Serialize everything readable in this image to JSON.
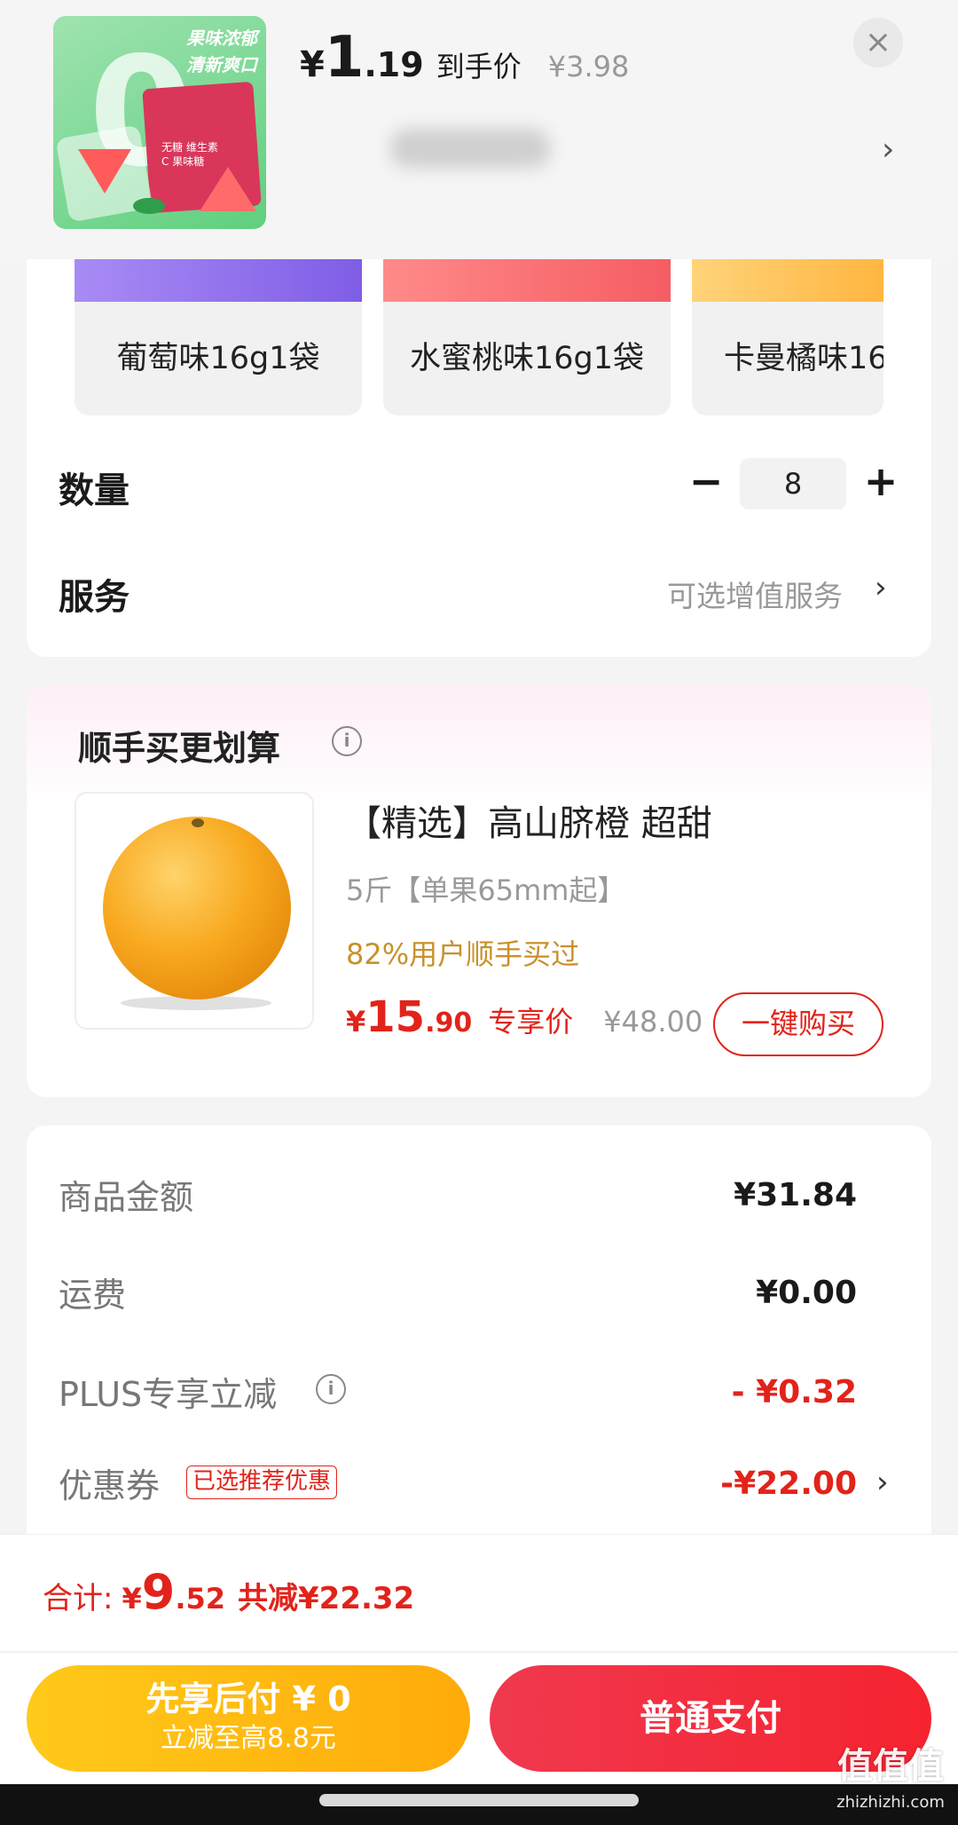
{
  "header": {
    "thumb_slogan_line1": "果味浓郁",
    "thumb_slogan_line2": "清新爽口",
    "thumb_zero": "0",
    "thumb_pack_text": "无糖 维生素C 果味糖",
    "price_currency": "¥",
    "price_int": "1",
    "price_dec": ".19",
    "price_label": "到手价",
    "original_price": "¥3.98",
    "close_icon": "close-icon",
    "chevron": "›"
  },
  "flavors": [
    {
      "label": "葡萄味16g1袋",
      "color": "#8f6ef0"
    },
    {
      "label": "水蜜桃味16g1袋",
      "color": "#f7676b"
    },
    {
      "label": "卡曼橘味16",
      "color": "#ffc555"
    }
  ],
  "quantity": {
    "label": "数量",
    "minus": "−",
    "value": "8",
    "plus": "+"
  },
  "service": {
    "label": "服务",
    "value": "可选增值服务",
    "chevron": "›"
  },
  "bundle": {
    "title": "顺手买更划算",
    "info_icon": "i",
    "product_title": "【精选】高山脐橙 超甜",
    "product_sub": "5斤【单果65mm起】",
    "social_proof": "82%用户顺手买过",
    "price_currency": "¥",
    "price_int": "15",
    "price_dec": ".90",
    "price_label": "专享价",
    "original_price": "¥48.00",
    "buy_button": "一键购买"
  },
  "summary": {
    "rows": [
      {
        "label": "商品金额",
        "value": "¥31.84"
      },
      {
        "label": "运费",
        "value": "¥0.00"
      },
      {
        "label": "PLUS专享立减",
        "value": "- ¥0.32"
      },
      {
        "label": "优惠券",
        "value": "-¥22.00"
      }
    ],
    "plus_info_icon": "i",
    "coupon_tag": "已选推荐优惠",
    "chevron": "›"
  },
  "bottom": {
    "total_label": "合计:",
    "total_currency": "¥",
    "total_int": "9",
    "total_dec": ".52",
    "total_saved": "共减¥22.32",
    "later_pay_line1": "先享后付 ¥ 0",
    "later_pay_line2": "立减至高8.8元",
    "normal_pay": "普通支付"
  },
  "watermark": {
    "line1": "值值值",
    "line2": "zhizhizhi.com"
  },
  "colors": {
    "accent_red": "#e2231a",
    "gold": "#c8912a",
    "yellow_button": "#ffb812",
    "red_button": "#f23040"
  }
}
